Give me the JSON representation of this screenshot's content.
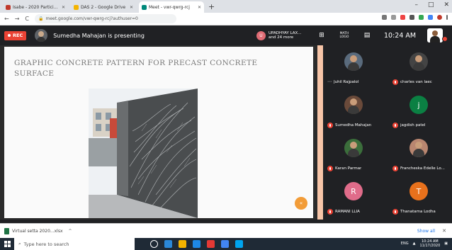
{
  "browser": {
    "tabs": [
      {
        "title": "Isabe - 2020 Participant List - g...",
        "active": false,
        "color": "#c0392b"
      },
      {
        "title": "DAS 2 - Google Drive",
        "active": false,
        "color": "#f4b400"
      },
      {
        "title": "Meet - vwr-qwrg-rcj",
        "active": true,
        "color": "#00897b"
      }
    ],
    "new_tab": "+",
    "window_controls": [
      "–",
      "□",
      "✕"
    ],
    "url": "meet.google.com/vwr-qwrg-rcj?authuser=0",
    "nav": [
      "←",
      "→",
      "C"
    ]
  },
  "meet": {
    "rec_label": "REC",
    "presenting_text": "Sumedha Mahajan is presenting",
    "host_chip": {
      "initial": "U",
      "name": "UPADHYAY LAX...",
      "more": "and 24 more"
    },
    "tools": [
      {
        "icon": "grid-icon",
        "glyph": "⊞",
        "label": ""
      },
      {
        "icon": "people-icon",
        "glyph": "",
        "label": "MATH LOGO"
      },
      {
        "icon": "chat-icon",
        "glyph": "▤",
        "label": ""
      }
    ],
    "clock": "10:24 AM"
  },
  "slide": {
    "title": "Graphic concrete pattern for precast concrete surface"
  },
  "participants": [
    {
      "name": "Juhil Rajpalol",
      "avatar_type": "photo",
      "initial": "",
      "color": "#5a6b7d",
      "muted": false
    },
    {
      "name": "charles van laec",
      "avatar_type": "photo",
      "initial": "",
      "color": "#444",
      "muted": true
    },
    {
      "name": "Sumedha Mahajan",
      "avatar_type": "photo",
      "initial": "",
      "color": "#6a4a3a",
      "muted": true
    },
    {
      "name": "jagdish patel",
      "avatar_type": "letter",
      "initial": "j",
      "color": "#0b8043",
      "muted": true
    },
    {
      "name": "Karan Parmar",
      "avatar_type": "photo",
      "initial": "",
      "color": "#3b6e3b",
      "muted": true
    },
    {
      "name": "Francheska Edelle Lo...",
      "avatar_type": "photo",
      "initial": "",
      "color": "#b98670",
      "muted": true
    },
    {
      "name": "RAMANI LLIA",
      "avatar_type": "letter",
      "initial": "R",
      "color": "#e06c8a",
      "muted": true
    },
    {
      "name": "Thanatama Lodha",
      "avatar_type": "letter",
      "initial": "T",
      "color": "#e8711c",
      "muted": true
    }
  ],
  "collapse_button": "«",
  "downloads": {
    "file": "Virtual setta 2020...xlsx",
    "caret": "^",
    "show_all": "Show all",
    "close": "✕"
  },
  "taskbar": {
    "search_placeholder": "Type here to search",
    "apps": [
      "#ffffff",
      "#2b88d8",
      "#f4b400",
      "#1e88e5",
      "#e53935",
      "#4285f4",
      "#00a4ef"
    ],
    "tray_lang": "ENG",
    "time": "10:24 AM",
    "date": "11/17/2020"
  }
}
